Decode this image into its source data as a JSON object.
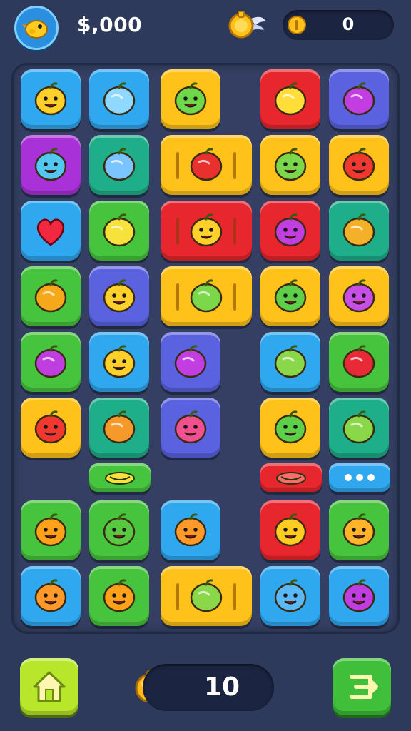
{
  "hud": {
    "score": "$,000",
    "coins": "0",
    "moves": "10"
  },
  "colors": {
    "background": "#2e3a5c",
    "board": "#343f63",
    "blue": "#2fa8f0",
    "purple": "#a832d8",
    "green": "#47c43e",
    "teal": "#1fae8a",
    "yellow": "#ffc21a",
    "red": "#e8262e",
    "indigo": "#5a62e0",
    "lime": "#b8e62a"
  },
  "tiles": [
    {
      "color": "blue",
      "icon": "yellow-duck-icon"
    },
    {
      "color": "blue",
      "icon": "blue-puzzle-icon"
    },
    {
      "color": "yellow",
      "icon": "green-monster-icon"
    },
    {
      "color": "red",
      "icon": "lollipop-icon"
    },
    {
      "color": "indigo",
      "icon": "purple-apple-icon"
    },
    {
      "color": "purple",
      "icon": "blue-ball-face-icon"
    },
    {
      "color": "teal",
      "icon": "blue-candy-icon"
    },
    {
      "color": "yellow",
      "icon": "red-strawberry-icon",
      "wide": true
    },
    {
      "color": "yellow",
      "icon": "green-frog-icon"
    },
    {
      "color": "yellow",
      "icon": "red-apple-face-icon"
    },
    {
      "color": "blue",
      "icon": "red-heart-icon"
    },
    {
      "color": "green",
      "icon": "lemon-icon"
    },
    {
      "color": "red",
      "icon": "yellow-blob-face-icon",
      "wide": true
    },
    {
      "color": "red",
      "icon": "purple-apple-face-icon"
    },
    {
      "color": "teal",
      "icon": "orange-melon-icon"
    },
    {
      "color": "green",
      "icon": "pineapple-icon"
    },
    {
      "color": "indigo",
      "icon": "yellow-star-face-icon"
    },
    {
      "color": "yellow",
      "icon": "green-leaf-icon",
      "wide": true
    },
    {
      "color": "yellow",
      "icon": "green-star-monster-icon"
    },
    {
      "color": "yellow",
      "icon": "purple-blob-icon"
    },
    {
      "color": "green",
      "icon": "purple-plum-icon"
    },
    {
      "color": "blue",
      "icon": "yellow-pear-face-icon"
    },
    {
      "color": "indigo",
      "icon": "purple-apple-icon"
    },
    {
      "color": "blue",
      "icon": "green-melon-icon"
    },
    {
      "color": "green",
      "icon": "red-pepper-icon"
    },
    {
      "color": "yellow",
      "icon": "red-apple-face-icon"
    },
    {
      "color": "teal",
      "icon": "orange-watermelon-icon"
    },
    {
      "color": "indigo",
      "icon": "pink-berry-face-icon"
    },
    {
      "color": "yellow",
      "icon": "green-blob-face-icon"
    },
    {
      "color": "teal",
      "icon": "green-melon-icon"
    },
    {
      "color": "green",
      "icon": "banana-icon",
      "bar": true
    },
    {
      "color": "red",
      "icon": "watermelon-slice-icon",
      "bar": true
    },
    {
      "color": "blue",
      "icon": "more-dots-icon",
      "bar": true
    },
    {
      "color": "green",
      "icon": "orange-face-icon"
    },
    {
      "color": "green",
      "icon": "green-apple-face-icon"
    },
    {
      "color": "blue",
      "icon": "orange-bear-face-icon"
    },
    {
      "color": "red",
      "icon": "yellow-face-icon"
    },
    {
      "color": "green",
      "icon": "orange-pear-face-icon"
    },
    {
      "color": "blue",
      "icon": "orange-bear-face-icon"
    },
    {
      "color": "green",
      "icon": "orange-face-icon"
    },
    {
      "color": "yellow",
      "icon": "green-melon-icon",
      "wide": true
    },
    {
      "color": "blue",
      "icon": "blue-smiley-icon"
    },
    {
      "color": "blue",
      "icon": "purple-plum-face-icon"
    }
  ]
}
